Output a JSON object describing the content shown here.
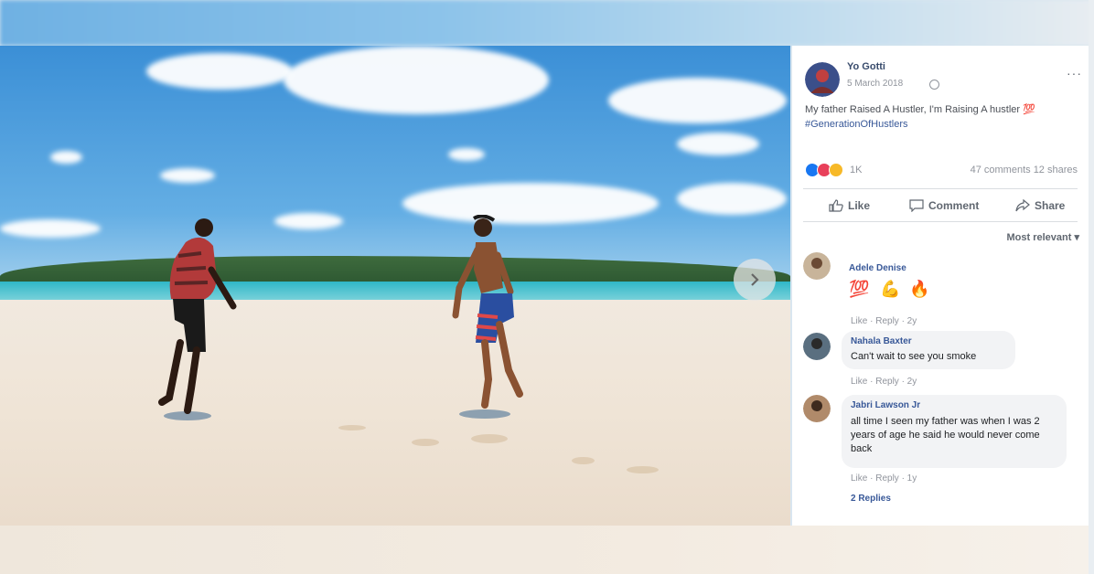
{
  "post": {
    "author": "Yo Gotti",
    "date": "5 March 2018",
    "text": "My father Raised A Hustler, I'm Raising A hustler",
    "hashtag": "#GenerationOfHustlers",
    "reaction_count": "1K",
    "stats": "47 comments 12 shares",
    "more_label": "···"
  },
  "actions": {
    "like": "Like",
    "comment": "Comment",
    "share": "Share"
  },
  "sort_label": "Most relevant ▾",
  "comments": [
    {
      "name": "Adele Denise",
      "emojis": [
        "💯",
        "💪",
        "🔥"
      ],
      "meta": "Like · Reply · 2y"
    },
    {
      "name": "Nahala Baxter",
      "text": "Can't wait to see you smoke",
      "meta": "Like · Reply · 2y"
    },
    {
      "name": "Jabri Lawson Jr",
      "text": "all time I seen my father was when I was 2 years of age he said he would never come back",
      "meta": "Like · Reply · 1y",
      "replies": "2 Replies"
    }
  ],
  "colors": {
    "sky": "#3b8fd6",
    "sand": "#efe4d6",
    "link": "#385898"
  },
  "icons": [
    "globe-icon",
    "like-icon",
    "comment-icon",
    "share-icon",
    "chevron-right-icon",
    "more-icon"
  ]
}
